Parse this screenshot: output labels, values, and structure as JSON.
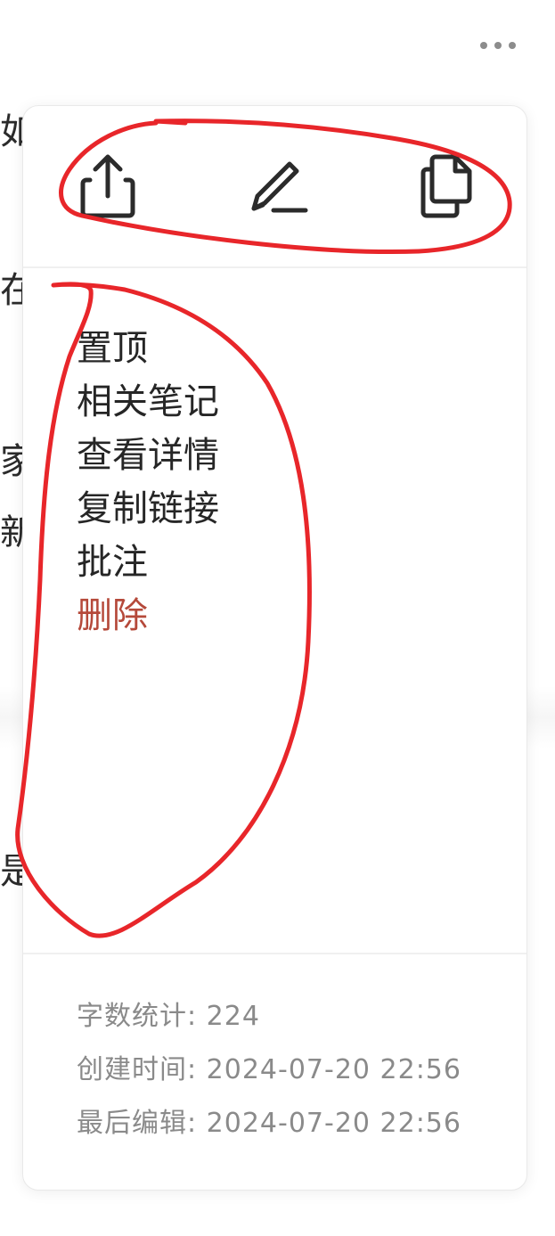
{
  "background": {
    "chars": [
      "如",
      "在",
      "家",
      "新",
      "是"
    ]
  },
  "toolbar": {
    "share_icon": "share-icon",
    "edit_icon": "pencil-icon",
    "copy_icon": "copy-icon"
  },
  "menu": {
    "items": [
      {
        "label": "置顶"
      },
      {
        "label": "相关笔记"
      },
      {
        "label": "查看详情"
      },
      {
        "label": "复制链接"
      },
      {
        "label": "批注"
      },
      {
        "label": "删除",
        "danger": true
      }
    ]
  },
  "stats": {
    "word_count": "字数统计: 224",
    "created": "创建时间: 2024-07-20 22:56",
    "last_edited": "最后编辑: 2024-07-20 22:56"
  },
  "colors": {
    "danger": "#b5493a",
    "annotation": "#e8262a"
  }
}
